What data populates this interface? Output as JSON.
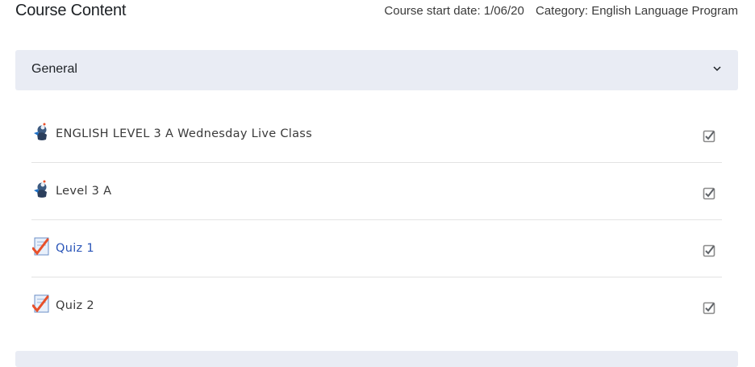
{
  "page": {
    "title": "Course Content",
    "start_date": "Course start date: 1/06/20",
    "category": "Category: English Language Program"
  },
  "section": {
    "title": "General",
    "toggle_icon": "chevron-down-icon"
  },
  "activities": [
    {
      "label": "ENGLISH LEVEL 3 A Wednesday Live Class",
      "icon": "bigbluebutton-icon",
      "completion_icon": "completion-checkbox-icon"
    },
    {
      "label": "Level 3 A",
      "icon": "bigbluebutton-icon",
      "completion_icon": "completion-checkbox-icon"
    },
    {
      "label": "Quiz 1",
      "icon": "quiz-icon",
      "completion_icon": "completion-checkbox-icon"
    },
    {
      "label": "Quiz 2",
      "icon": "quiz-icon",
      "completion_icon": "completion-checkbox-icon"
    }
  ],
  "colors": {
    "section_bg": "#e9ecf4",
    "link": "#2a55b8",
    "quiz_check": "#e8502a"
  }
}
